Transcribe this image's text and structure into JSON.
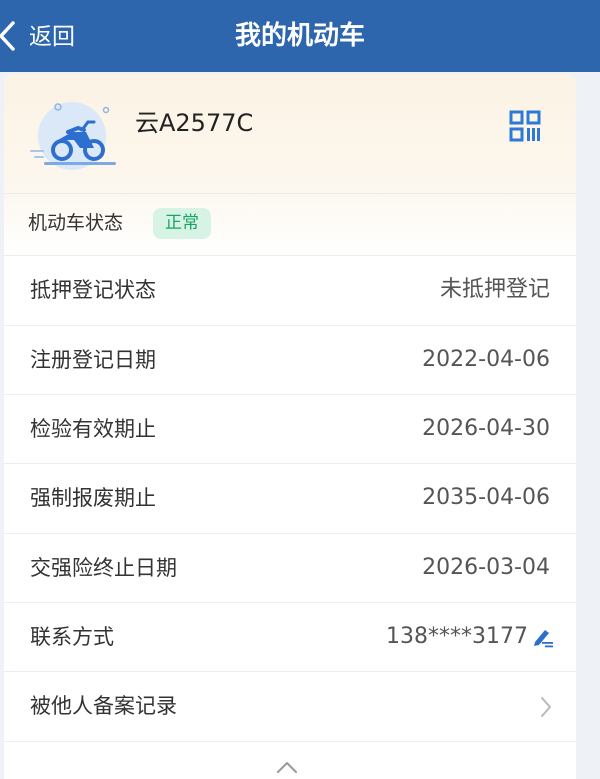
{
  "header": {
    "back_label": "返回",
    "title": "我的机动车"
  },
  "vehicle": {
    "plate": "云A2577C",
    "icon": "motorcycle-icon",
    "qr_icon": "qr-code-icon"
  },
  "status": {
    "label": "机动车状态",
    "value": "正常"
  },
  "rows": [
    {
      "label": "抵押登记状态",
      "value": "未抵押登记"
    },
    {
      "label": "注册登记日期",
      "value": "2022-04-06"
    },
    {
      "label": "检验有效期止",
      "value": "2026-04-30"
    },
    {
      "label": "强制报废期止",
      "value": "2035-04-06"
    },
    {
      "label": "交强险终止日期",
      "value": "2026-03-04"
    },
    {
      "label": "联系方式",
      "value": "138****3177",
      "icon": "edit-icon"
    },
    {
      "label": "被他人备案记录",
      "icon": "chevron-right-icon"
    }
  ],
  "colors": {
    "header_bg": "#2e66ad",
    "accent_blue": "#2d79d8",
    "badge_bg": "#d7f3e5",
    "badge_text": "#18a463"
  }
}
